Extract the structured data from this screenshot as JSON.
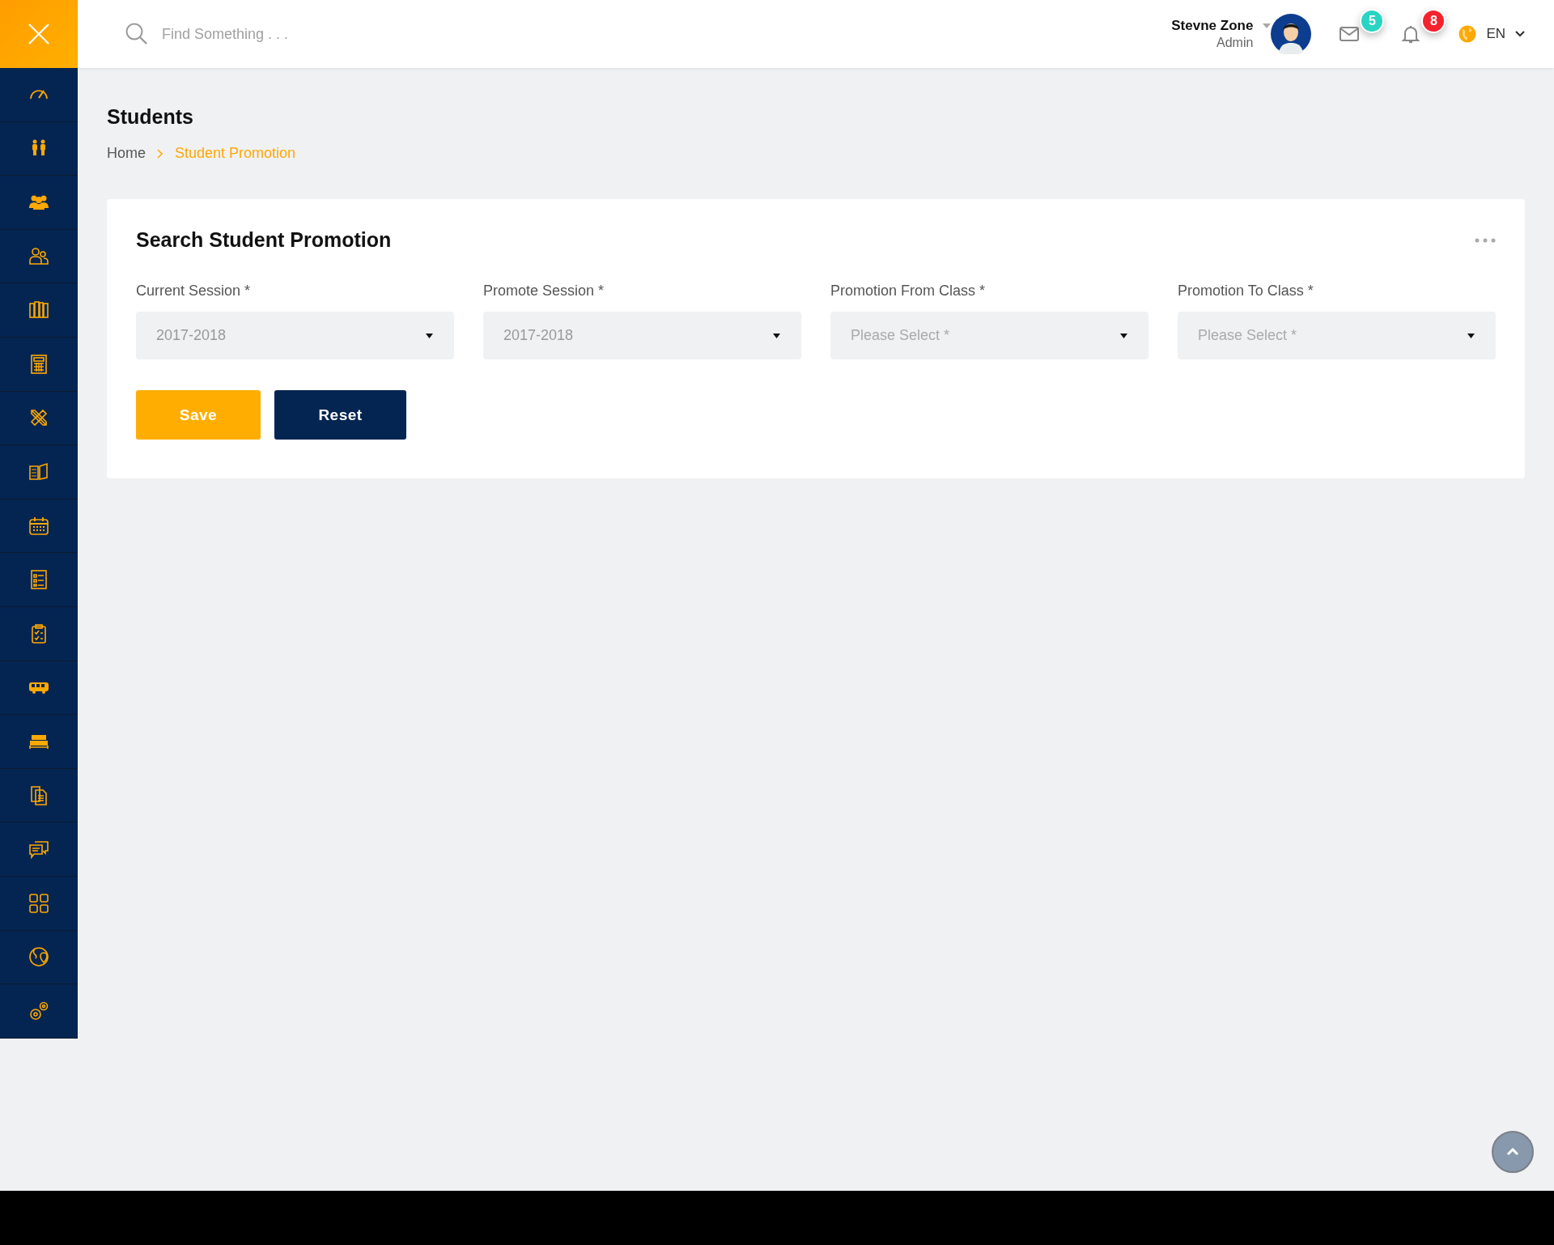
{
  "search": {
    "placeholder": "Find Something . . ."
  },
  "user": {
    "name": "Stevne Zone",
    "role": "Admin"
  },
  "notifications": [
    {
      "kind": "mail",
      "count": "5",
      "color": "#2ad4c3"
    },
    {
      "kind": "bell",
      "count": "8",
      "color": "#f5222d"
    }
  ],
  "language": {
    "label": "EN"
  },
  "page": {
    "title": "Students",
    "breadcrumb": [
      {
        "label": "Home",
        "selected": false
      },
      {
        "label": "Student Promotion",
        "selected": true
      }
    ]
  },
  "card": {
    "title": "Search Student Promotion",
    "fields": [
      {
        "label": "Current Session *",
        "value": "2017-2018"
      },
      {
        "label": "Promote Session *",
        "value": "2017-2018"
      },
      {
        "label": "Promotion From Class *",
        "placeholder": "Please Select *"
      },
      {
        "label": "Promotion To Class *",
        "placeholder": "Please Select *"
      }
    ],
    "buttons": [
      {
        "kind": "primary",
        "label": "Save"
      },
      {
        "kind": "secondary",
        "label": "Reset"
      }
    ]
  }
}
